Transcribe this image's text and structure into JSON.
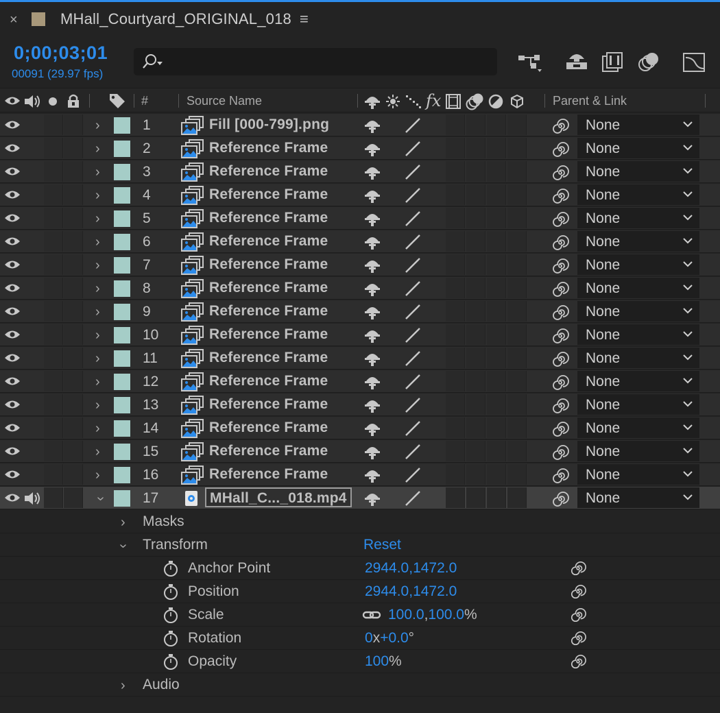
{
  "composition": {
    "title": "MHall_Courtyard_ORIGINAL_018",
    "label_color": "#a8987a"
  },
  "timecode": {
    "current": "0;00;03;01",
    "frame_info": "00091 (29.97 fps)"
  },
  "search": {
    "placeholder": ""
  },
  "toolbar": {
    "icons": [
      "composition-flowchart-icon",
      "draft-3d-icon",
      "frame-blending-icon",
      "motion-blur-icon",
      "graph-editor-icon"
    ]
  },
  "columns": {
    "number": "#",
    "source_name": "Source Name",
    "parent_link": "Parent & Link"
  },
  "layers": [
    {
      "num": "1",
      "name": "Fill  [000-799].png",
      "parent": "None",
      "type": "sequence"
    },
    {
      "num": "2",
      "name": "Reference Frame",
      "parent": "None",
      "type": "sequence"
    },
    {
      "num": "3",
      "name": "Reference Frame",
      "parent": "None",
      "type": "sequence"
    },
    {
      "num": "4",
      "name": "Reference Frame",
      "parent": "None",
      "type": "sequence"
    },
    {
      "num": "5",
      "name": "Reference Frame",
      "parent": "None",
      "type": "sequence"
    },
    {
      "num": "6",
      "name": "Reference Frame",
      "parent": "None",
      "type": "sequence"
    },
    {
      "num": "7",
      "name": "Reference Frame",
      "parent": "None",
      "type": "sequence"
    },
    {
      "num": "8",
      "name": "Reference Frame",
      "parent": "None",
      "type": "sequence"
    },
    {
      "num": "9",
      "name": "Reference Frame",
      "parent": "None",
      "type": "sequence"
    },
    {
      "num": "10",
      "name": "Reference Frame",
      "parent": "None",
      "type": "sequence"
    },
    {
      "num": "11",
      "name": "Reference Frame",
      "parent": "None",
      "type": "sequence"
    },
    {
      "num": "12",
      "name": "Reference Frame",
      "parent": "None",
      "type": "sequence"
    },
    {
      "num": "13",
      "name": "Reference Frame",
      "parent": "None",
      "type": "sequence"
    },
    {
      "num": "14",
      "name": "Reference Frame",
      "parent": "None",
      "type": "sequence"
    },
    {
      "num": "15",
      "name": "Reference Frame",
      "parent": "None",
      "type": "sequence"
    },
    {
      "num": "16",
      "name": "Reference Frame",
      "parent": "None",
      "type": "sequence"
    },
    {
      "num": "17",
      "name": "MHall_C..._018.mp4",
      "parent": "None",
      "type": "video",
      "selected": true,
      "expanded": true
    }
  ],
  "layer_label_color": "#a5cdc7",
  "groups": {
    "masks": "Masks",
    "transform": "Transform",
    "transform_reset": "Reset",
    "audio": "Audio"
  },
  "properties": [
    {
      "name": "Anchor Point",
      "value": "2944.0,1472.0"
    },
    {
      "name": "Position",
      "value": "2944.0,1472.0"
    },
    {
      "name": "Scale",
      "value_x": "100.0",
      "value_sep": ",",
      "value_y": "100.0",
      "unit": "%"
    },
    {
      "name": "Rotation",
      "value_a": "0",
      "value_a_unit": "x",
      "value_b": "+0.0",
      "value_b_unit": "°"
    },
    {
      "name": "Opacity",
      "value": "100",
      "unit": "%"
    }
  ],
  "accent_color": "#2d8ceb"
}
